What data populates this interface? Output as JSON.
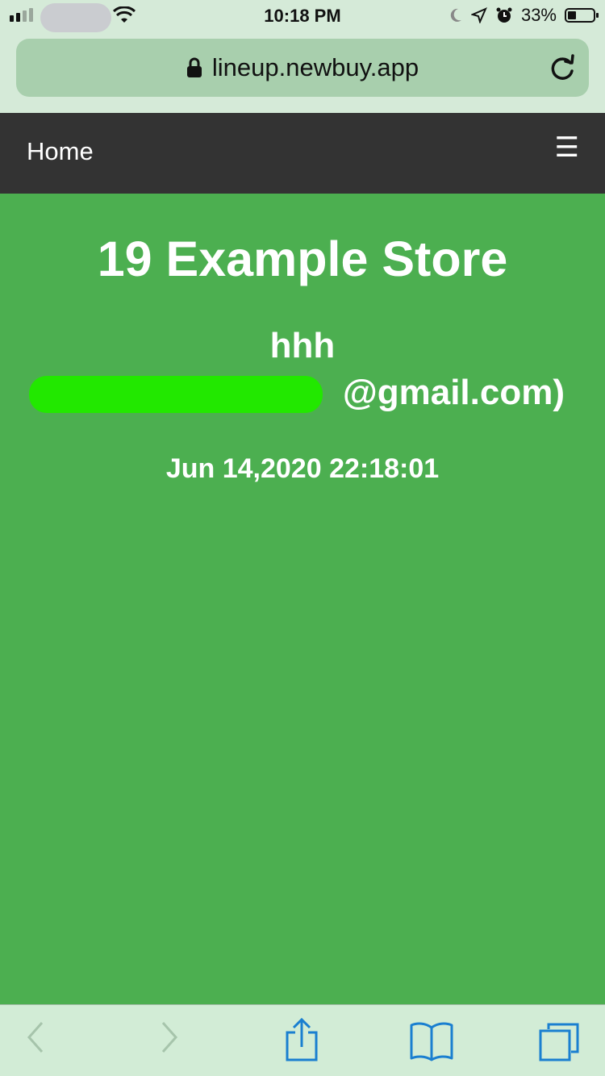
{
  "status_bar": {
    "time": "10:18 PM",
    "battery_percent": "33%",
    "battery_level": 0.33,
    "icons": [
      "signal-icon",
      "wifi-icon",
      "moon-icon",
      "location-icon",
      "alarm-icon",
      "battery-icon"
    ]
  },
  "browser": {
    "url": "lineup.newbuy.app"
  },
  "nav": {
    "home_label": "Home",
    "menu_glyph": "☰"
  },
  "store": {
    "title": "19 Example Store",
    "customer_name": "hhh",
    "email_visible_suffix": "@gmail.com)",
    "timestamp": "Jun 14,2020 22:18:01"
  },
  "colors": {
    "page_background": "#4caf50",
    "navbar": "#333333",
    "browser_chrome": "#d5ead8",
    "toolbar_icon": "#1a7fd0",
    "redaction": "#22e800"
  },
  "toolbar": {
    "icons": [
      "back-icon",
      "forward-icon",
      "share-icon",
      "bookmarks-icon",
      "tabs-icon"
    ]
  }
}
